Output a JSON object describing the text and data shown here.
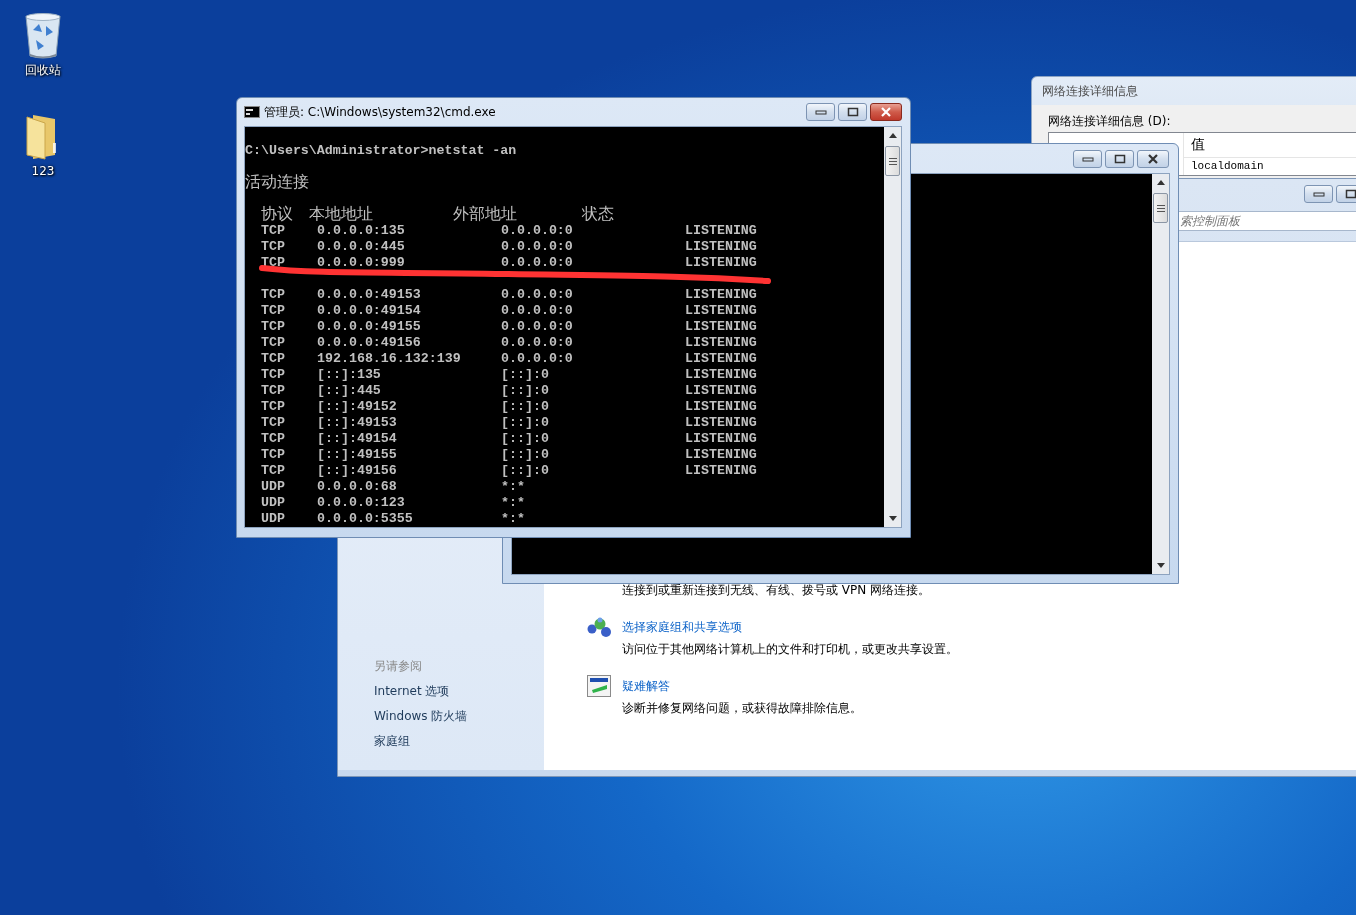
{
  "desktop_icons": [
    {
      "kind": "recycle_bin",
      "label": "回收站"
    },
    {
      "kind": "folder",
      "label": "123"
    }
  ],
  "network_details": {
    "title": "网络连接详细信息",
    "list_label": "网络连接详细信息 (D):",
    "columns": [
      "值"
    ],
    "rows": [
      [
        "localdomain"
      ]
    ]
  },
  "control_panel": {
    "search_placeholder": "索控制面板",
    "see_also": {
      "heading": "另请参阅",
      "links": [
        "Internet 选项",
        "Windows 防火墙",
        "家庭组"
      ]
    },
    "tasks": [
      {
        "kind": "text",
        "description": "连接到或重新连接到无线、有线、拨号或 VPN 网络连接。"
      },
      {
        "kind": "homegroup",
        "link": "选择家庭组和共享选项",
        "description": "访问位于其他网络计算机上的文件和打印机，或更改共享设置。"
      },
      {
        "kind": "troubleshoot",
        "link": "疑难解答",
        "description": "诊断并修复网络问题，或获得故障排除信息。"
      }
    ]
  },
  "console_window": {
    "title": "管理员: C:\\Windows\\system32\\cmd.exe",
    "prompt": "C:\\Users\\Administrator>netstat -an",
    "heading": "活动连接",
    "columns": [
      "协议",
      "本地地址",
      "外部地址",
      "状态"
    ],
    "rows": [
      {
        "kind": "entry",
        "cells": [
          "TCP",
          "0.0.0.0:135",
          "0.0.0.0:0",
          "LISTENING"
        ]
      },
      {
        "kind": "entry",
        "cells": [
          "TCP",
          "0.0.0.0:445",
          "0.0.0.0:0",
          "LISTENING"
        ]
      },
      {
        "kind": "entry",
        "cells": [
          "TCP",
          "0.0.0.0:999",
          "0.0.0.0:0",
          "LISTENING"
        ]
      },
      {
        "kind": "obscured"
      },
      {
        "kind": "entry",
        "cells": [
          "TCP",
          "0.0.0.0:49153",
          "0.0.0.0:0",
          "LISTENING"
        ]
      },
      {
        "kind": "entry",
        "cells": [
          "TCP",
          "0.0.0.0:49154",
          "0.0.0.0:0",
          "LISTENING"
        ]
      },
      {
        "kind": "entry",
        "cells": [
          "TCP",
          "0.0.0.0:49155",
          "0.0.0.0:0",
          "LISTENING"
        ]
      },
      {
        "kind": "entry",
        "cells": [
          "TCP",
          "0.0.0.0:49156",
          "0.0.0.0:0",
          "LISTENING"
        ]
      },
      {
        "kind": "entry",
        "cells": [
          "TCP",
          "192.168.16.132:139",
          "0.0.0.0:0",
          "LISTENING"
        ]
      },
      {
        "kind": "entry",
        "cells": [
          "TCP",
          "[::]:135",
          "[::]:0",
          "LISTENING"
        ]
      },
      {
        "kind": "entry",
        "cells": [
          "TCP",
          "[::]:445",
          "[::]:0",
          "LISTENING"
        ]
      },
      {
        "kind": "entry",
        "cells": [
          "TCP",
          "[::]:49152",
          "[::]:0",
          "LISTENING"
        ]
      },
      {
        "kind": "entry",
        "cells": [
          "TCP",
          "[::]:49153",
          "[::]:0",
          "LISTENING"
        ]
      },
      {
        "kind": "entry",
        "cells": [
          "TCP",
          "[::]:49154",
          "[::]:0",
          "LISTENING"
        ]
      },
      {
        "kind": "entry",
        "cells": [
          "TCP",
          "[::]:49155",
          "[::]:0",
          "LISTENING"
        ]
      },
      {
        "kind": "entry",
        "cells": [
          "TCP",
          "[::]:49156",
          "[::]:0",
          "LISTENING"
        ]
      },
      {
        "kind": "entry",
        "cells": [
          "UDP",
          "0.0.0.0:68",
          "*:*"
        ]
      },
      {
        "kind": "entry",
        "cells": [
          "UDP",
          "0.0.0.0:123",
          "*:*"
        ]
      },
      {
        "kind": "entry",
        "cells": [
          "UDP",
          "0.0.0.0:5355",
          "*:*"
        ]
      }
    ]
  }
}
